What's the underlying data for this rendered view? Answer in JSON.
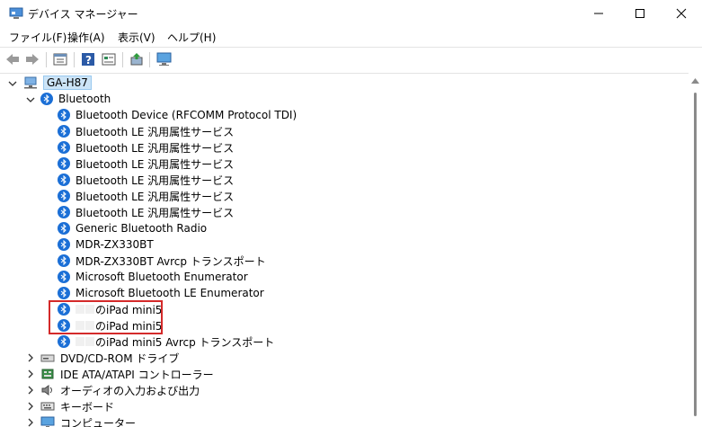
{
  "window": {
    "title": "デバイス マネージャー"
  },
  "menu": [
    "ファイル(F)",
    "操作(A)",
    "表示(V)",
    "ヘルプ(H)"
  ],
  "toolbar_icons": [
    "back-arrow-icon",
    "forward-arrow-icon",
    "properties-icon",
    "help-icon",
    "view-icon",
    "update-driver-icon",
    "monitor-icon"
  ],
  "tree": {
    "root": "GA-H87",
    "bluetooth": {
      "label": "Bluetooth",
      "devices": [
        "Bluetooth Device (RFCOMM Protocol TDI)",
        "Bluetooth LE 汎用属性サービス",
        "Bluetooth LE 汎用属性サービス",
        "Bluetooth LE 汎用属性サービス",
        "Bluetooth LE 汎用属性サービス",
        "Bluetooth LE 汎用属性サービス",
        "Bluetooth LE 汎用属性サービス",
        "Generic Bluetooth Radio",
        "MDR-ZX330BT",
        "MDR-ZX330BT Avrcp トランスポート",
        "Microsoft Bluetooth Enumerator",
        "Microsoft Bluetooth LE Enumerator",
        "のiPad mini5",
        "のiPad mini5",
        "のiPad mini5 Avrcp トランスポート"
      ]
    },
    "categories": [
      "DVD/CD-ROM ドライブ",
      "IDE ATA/ATAPI コントローラー",
      "オーディオの入力および出力",
      "キーボード",
      "コンピューター"
    ]
  },
  "colors": {
    "bluetooth": "#1b6fd6",
    "highlight": "#d42a2a",
    "selection": "#cce4f7"
  }
}
